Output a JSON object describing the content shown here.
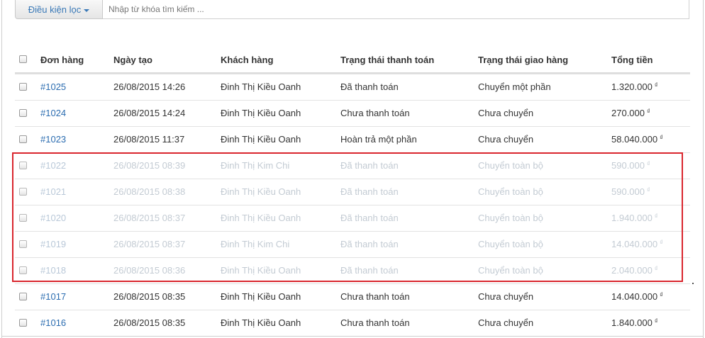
{
  "filter": {
    "button_label": "Điều kiện lọc",
    "search_placeholder": "Nhập từ khóa tìm kiếm ..."
  },
  "table": {
    "headers": {
      "order": "Đơn hàng",
      "date": "Ngày tạo",
      "customer": "Khách hàng",
      "payment": "Trạng thái thanh toán",
      "shipping": "Trạng thái giao hàng",
      "total": "Tổng tiền"
    },
    "currency_symbol": "₫",
    "rows": [
      {
        "order": "#1025",
        "date": "26/08/2015 14:26",
        "customer": "Đinh Thị Kiều Oanh",
        "payment": "Đã thanh toán",
        "shipping": "Chuyển một phần",
        "total": "1.320.000"
      },
      {
        "order": "#1024",
        "date": "26/08/2015 14:24",
        "customer": "Đinh Thị Kiều Oanh",
        "payment": "Chưa thanh toán",
        "shipping": "Chưa chuyển",
        "total": "270.000"
      },
      {
        "order": "#1023",
        "date": "26/08/2015 11:37",
        "customer": "Đinh Thị Kiều Oanh",
        "payment": "Hoàn trả một phần",
        "shipping": "Chưa chuyển",
        "total": "58.040.000"
      },
      {
        "order": "#1022",
        "date": "26/08/2015 08:39",
        "customer": "Đinh Thị Kim Chi",
        "payment": "Đã thanh toán",
        "shipping": "Chuyển toàn bộ",
        "total": "590.000"
      },
      {
        "order": "#1021",
        "date": "26/08/2015 08:38",
        "customer": "Đinh Thị Kiều Oanh",
        "payment": "Đã thanh toán",
        "shipping": "Chuyển toàn bộ",
        "total": "590.000"
      },
      {
        "order": "#1020",
        "date": "26/08/2015 08:37",
        "customer": "Đinh Thị Kiều Oanh",
        "payment": "Đã thanh toán",
        "shipping": "Chuyển toàn bộ",
        "total": "1.940.000"
      },
      {
        "order": "#1019",
        "date": "26/08/2015 08:37",
        "customer": "Đinh Thị Kim Chi",
        "payment": "Đã thanh toán",
        "shipping": "Chuyển toàn bộ",
        "total": "14.040.000"
      },
      {
        "order": "#1018",
        "date": "26/08/2015 08:36",
        "customer": "Đinh Thị Kiều Oanh",
        "payment": "Đã thanh toán",
        "shipping": "Chuyển toàn bộ",
        "total": "2.040.000"
      },
      {
        "order": "#1017",
        "date": "26/08/2015 08:35",
        "customer": "Đinh Thị Kiều Oanh",
        "payment": "Chưa thanh toán",
        "shipping": "Chưa chuyển",
        "total": "14.040.000"
      },
      {
        "order": "#1016",
        "date": "26/08/2015 08:35",
        "customer": "Đinh Thị Kiều Oanh",
        "payment": "Chưa thanh toán",
        "shipping": "Chưa chuyển",
        "total": "1.840.000"
      }
    ]
  },
  "colors": {
    "link": "#2b6cb0",
    "highlight_border": "#d9262e",
    "faded_text": "#c3cbd3"
  }
}
